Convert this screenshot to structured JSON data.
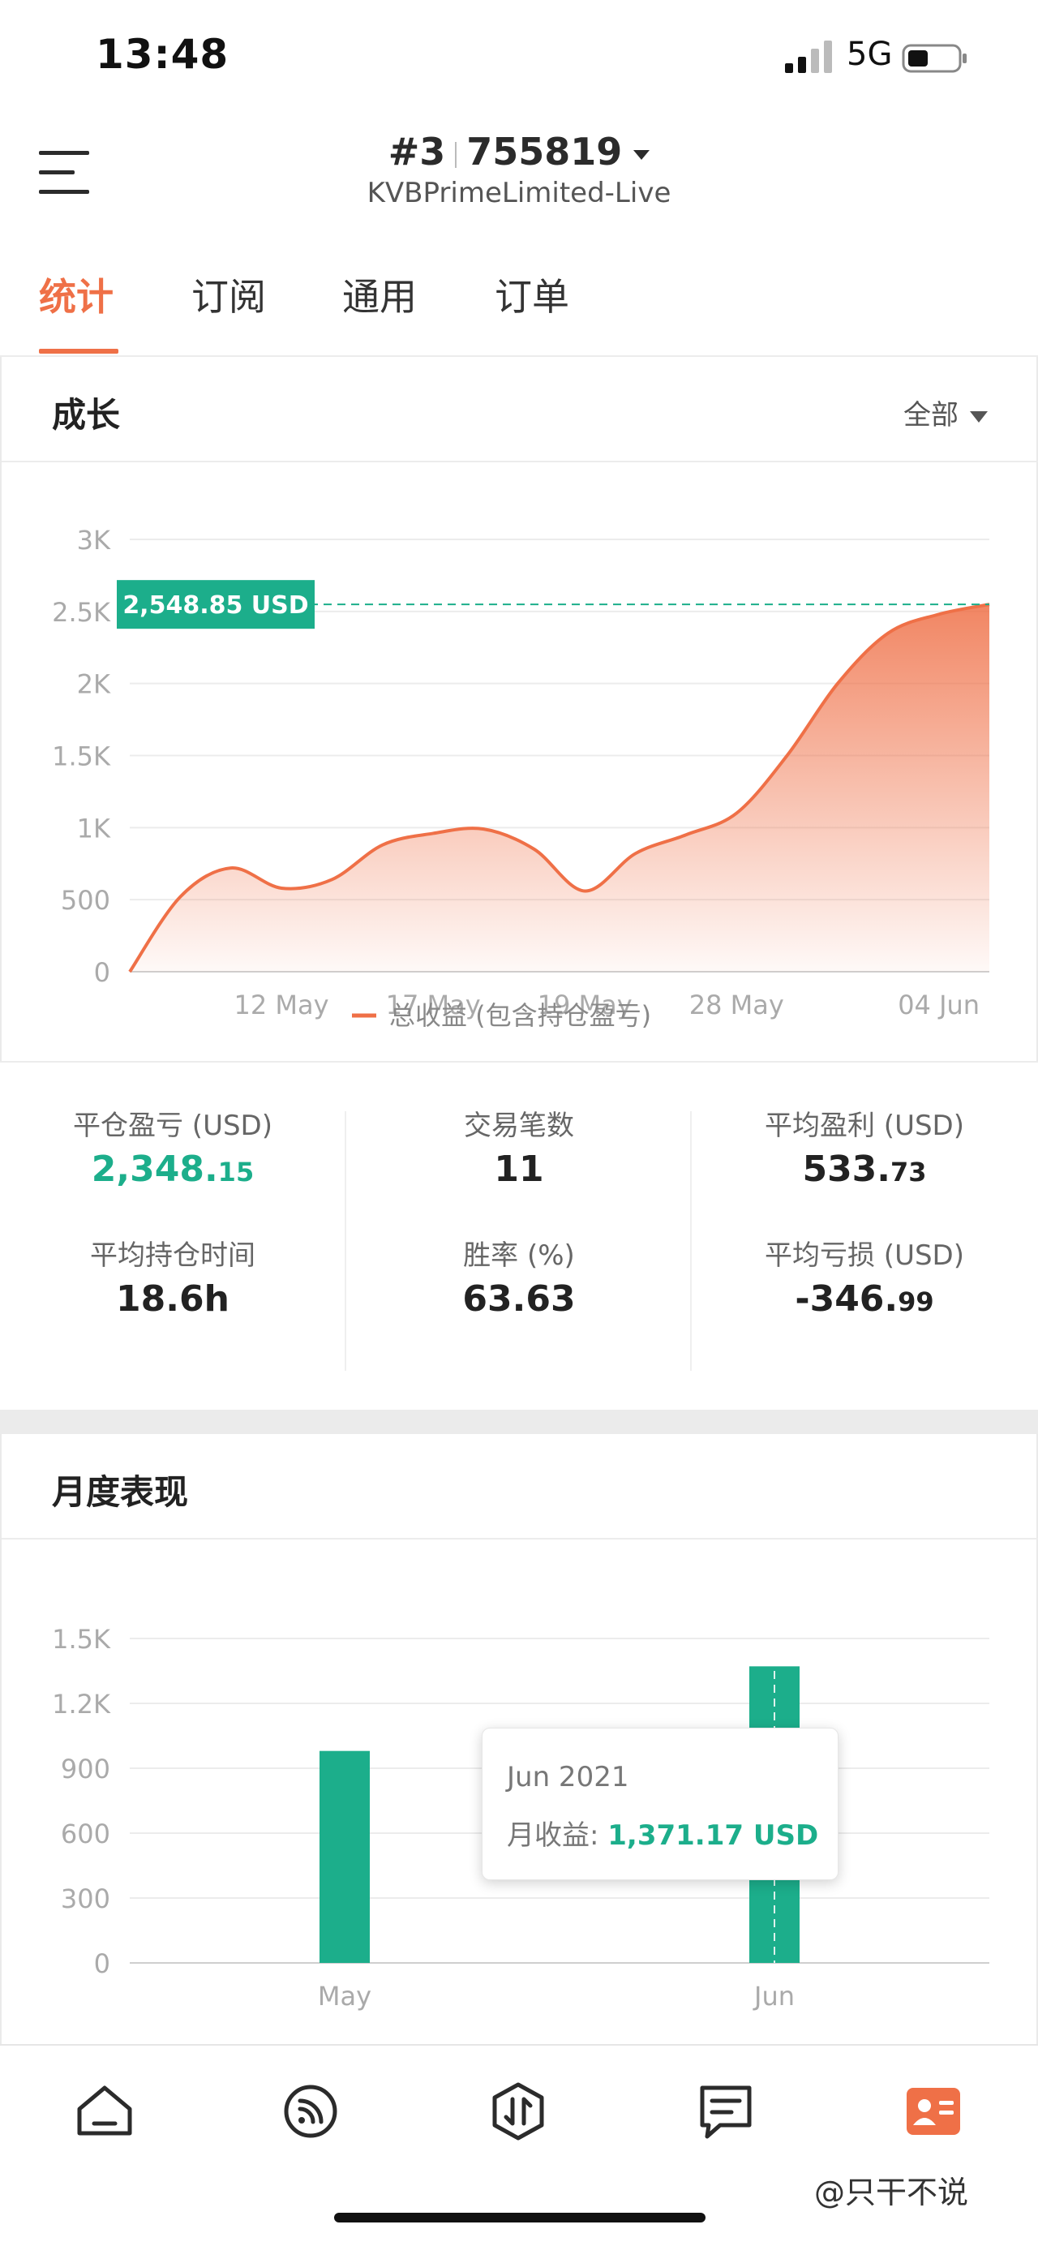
{
  "status_bar": {
    "time": "13:48",
    "network": "5G"
  },
  "header": {
    "account_num": "#3",
    "account_id": "755819",
    "server": "KVBPrimeLimited-Live"
  },
  "tabs": [
    {
      "label": "统计",
      "active": true
    },
    {
      "label": "订阅",
      "active": false
    },
    {
      "label": "通用",
      "active": false
    },
    {
      "label": "订单",
      "active": false
    }
  ],
  "growth": {
    "title": "成长",
    "filter": "全部",
    "current_label": "2,548.85 USD",
    "legend": "总收益 (包含持仓盈亏)"
  },
  "stats": {
    "closed_pnl": {
      "label": "平仓盈亏 (USD)",
      "int": "2,348.",
      "frac": "15"
    },
    "trades": {
      "label": "交易笔数",
      "value": "11"
    },
    "avg_profit": {
      "label": "平均盈利 (USD)",
      "int": "533.",
      "frac": "73"
    },
    "avg_hold": {
      "label": "平均持仓时间",
      "value": "18.6h"
    },
    "win_rate": {
      "label": "胜率 (%)",
      "value": "63.63"
    },
    "avg_loss": {
      "label": "平均亏损 (USD)",
      "int": "-346.",
      "frac": "99"
    }
  },
  "monthly": {
    "title": "月度表现",
    "tooltip_title": "Jun 2021",
    "tooltip_label": "月收益: ",
    "tooltip_value": "1,371.17 USD"
  },
  "bottom_nav": [
    "home-icon",
    "signal-feed-icon",
    "trade-icon",
    "messages-icon",
    "profile-card-icon"
  ],
  "watermark": "@只干不说",
  "colors": {
    "accent": "#ef7047",
    "green": "#1cae8b",
    "grid": "#ececec"
  },
  "chart_data": [
    {
      "type": "area",
      "title": "",
      "xlabel": "",
      "ylabel": "",
      "x": [
        "",
        "",
        "",
        "12 May",
        "",
        "",
        "17 May",
        "",
        "",
        "19 May",
        "",
        "",
        "28 May",
        "",
        "",
        "",
        "04 Jun",
        ""
      ],
      "series": [
        {
          "name": "总收益 (包含持仓盈亏)",
          "values": [
            0,
            520,
            720,
            580,
            640,
            880,
            960,
            990,
            850,
            560,
            820,
            950,
            1100,
            1500,
            2000,
            2350,
            2480,
            2549
          ]
        }
      ],
      "yticks": [
        "0",
        "500",
        "1K",
        "1.5K",
        "2K",
        "2.5K",
        "3K"
      ],
      "xticks": [
        "12 May",
        "17 May",
        "19 May",
        "28 May",
        "04 Jun"
      ],
      "ylim": [
        0,
        3000
      ],
      "reference_line": 2548.85,
      "grid": true
    },
    {
      "type": "bar",
      "title": "",
      "xlabel": "",
      "ylabel": "",
      "categories": [
        "May",
        "Jun"
      ],
      "values": [
        980,
        1371.17
      ],
      "yticks": [
        "0",
        "300",
        "600",
        "900",
        "1.2K",
        "1.5K"
      ],
      "ylim": [
        0,
        1500
      ],
      "grid": true
    }
  ]
}
